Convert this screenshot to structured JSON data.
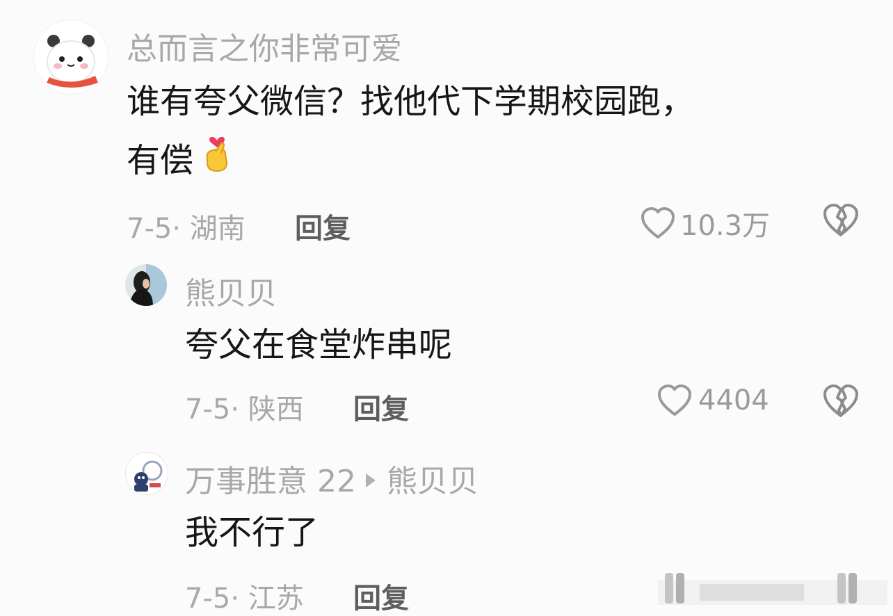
{
  "comments": [
    {
      "username": "总而言之你非常可爱",
      "content_line1": "谁有夸父微信？找他代下学期校园跑，",
      "content_line2": "有偿",
      "date": "7-5",
      "location": "湖南",
      "reply_label": "回复",
      "likes": "10.3万"
    },
    {
      "username": "熊贝贝",
      "content": "夸父在食堂炸串呢",
      "date": "7-5",
      "location": "陕西",
      "reply_label": "回复",
      "likes": "4404"
    },
    {
      "username": "万事胜意 22",
      "reply_to": "熊贝贝",
      "content": "我不行了",
      "date": "7-5",
      "location": "江苏",
      "reply_label": "回复"
    }
  ],
  "icons": {
    "like": "heart-outline-icon",
    "dislike": "broken-heart-icon",
    "emoji": "finger-heart-emoji-icon"
  },
  "colors": {
    "background": "#fbfbfb",
    "text_primary": "#161616",
    "text_secondary": "#a8a8a8",
    "reply_text": "#5e5e5e"
  }
}
